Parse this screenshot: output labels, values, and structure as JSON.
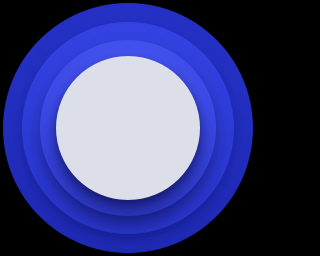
{
  "icon": {
    "name": "concentric-circle-app-icon",
    "colors": {
      "background": "#000000",
      "outer_ring": "#2330c2",
      "middle_ring": "#3140de",
      "inner_ring": "#3c4ae8",
      "core_disc": "#dcdfe8"
    }
  }
}
